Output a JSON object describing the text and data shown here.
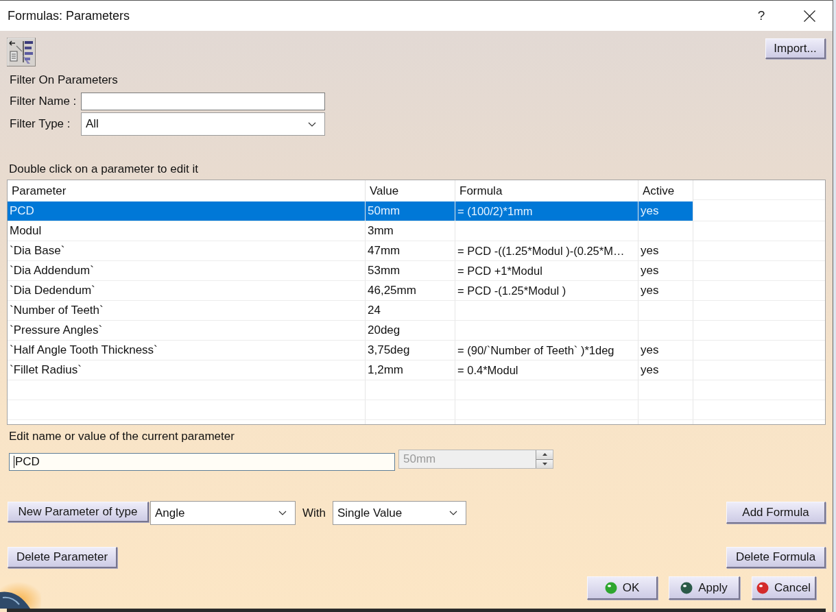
{
  "window": {
    "title": "Formulas: Parameters",
    "help": "?"
  },
  "toolbar": {
    "import_button": "Import..."
  },
  "filter": {
    "heading": "Filter On Parameters",
    "name_label": "Filter Name :",
    "type_label": "Filter Type :",
    "type_value": "All"
  },
  "table": {
    "caption": "Double click on a parameter to edit it",
    "columns": [
      "Parameter",
      "Value",
      "Formula",
      "Active"
    ],
    "rows": [
      {
        "parameter": "PCD",
        "value": "50mm",
        "formula": "= (100/2)*1mm",
        "active": "yes",
        "selected": true
      },
      {
        "parameter": "Modul",
        "value": "3mm",
        "selected": false
      },
      {
        "parameter": "`Dia Base`",
        "value": "47mm",
        "formula": "= PCD -((1.25*Modul )-(0.25*M…",
        "active": "yes",
        "selected": false
      },
      {
        "parameter": "`Dia Addendum`",
        "value": "53mm",
        "formula": "= PCD +1*Modul",
        "active": "yes",
        "selected": false
      },
      {
        "parameter": "`Dia Dedendum`",
        "value": "46,25mm",
        "formula": "= PCD -(1.25*Modul )",
        "active": "yes",
        "selected": false
      },
      {
        "parameter": "`Number of Teeth`",
        "value": "24",
        "selected": false
      },
      {
        "parameter": "`Pressure Angles`",
        "value": "20deg",
        "selected": false
      },
      {
        "parameter": "`Half Angle Tooth Thickness`",
        "value": "3,75deg",
        "formula": "= (90/`Number of Teeth` )*1deg",
        "active": "yes",
        "selected": false
      },
      {
        "parameter": "`Fillet Radius`",
        "value": "1,2mm",
        "formula": "= 0.4*Modul",
        "active": "yes",
        "selected": false
      }
    ]
  },
  "editor": {
    "caption": "Edit name or value of the current parameter",
    "name_value": "PCD",
    "value_field": {
      "value": "50mm",
      "disabled": true
    }
  },
  "new_parameter": {
    "button": "New Parameter of type",
    "type_value": "Angle",
    "with_label": "With",
    "with_value": "Single Value"
  },
  "formula_buttons": {
    "add": "Add Formula",
    "delete": "Delete Formula"
  },
  "delete_parameter_button": "Delete Parameter",
  "dialog_buttons": [
    {
      "label": "OK",
      "color": "#2ea62e"
    },
    {
      "label": "Apply",
      "color": "#2b5a48"
    },
    {
      "label": "Cancel",
      "color": "#d42b2b"
    }
  ]
}
